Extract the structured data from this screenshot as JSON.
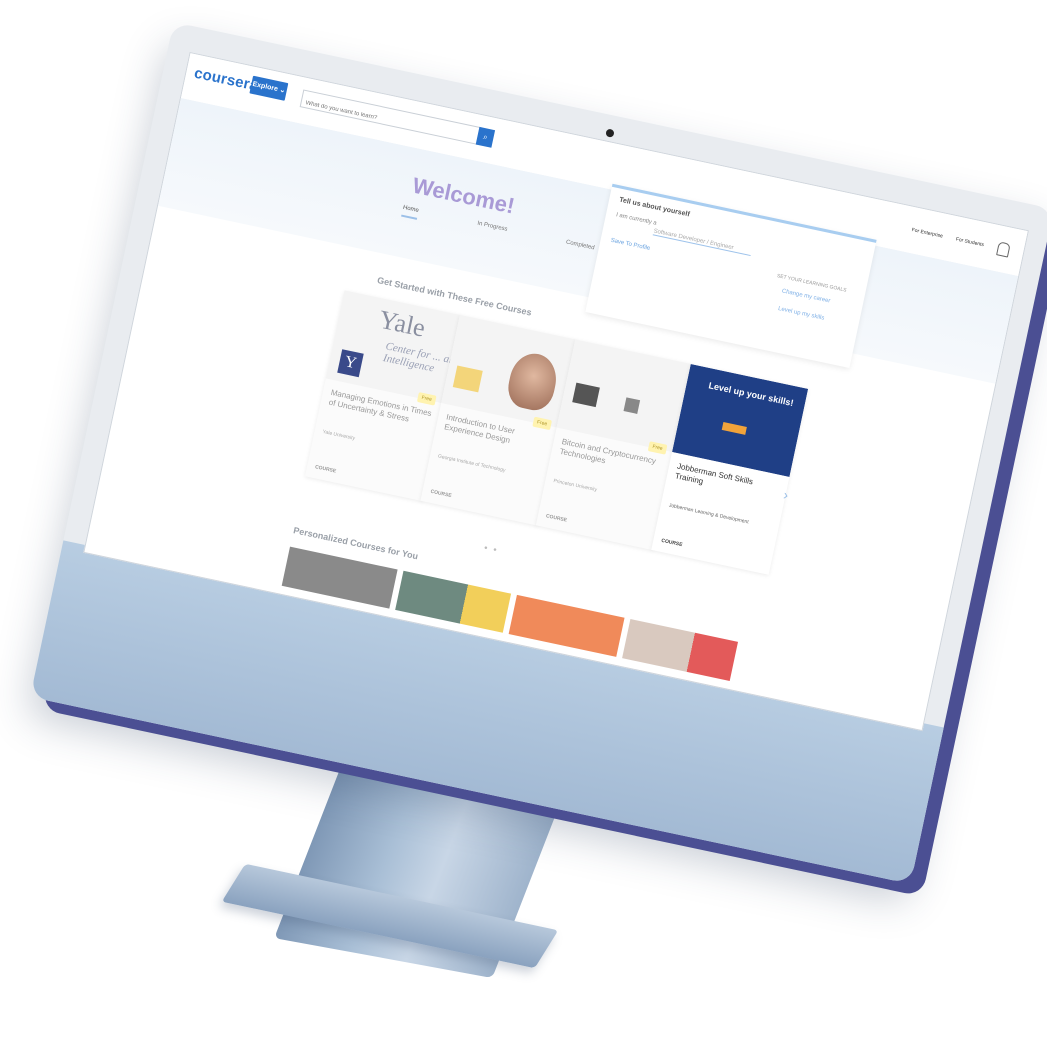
{
  "header": {
    "logo": "coursera",
    "explore_label": "Explore ⌄",
    "search_placeholder": "What do you want to learn?",
    "links": [
      "For Enterprise",
      "For Students"
    ]
  },
  "hero": {
    "welcome": "Welcome!",
    "tabs": [
      "Home",
      "In Progress",
      "Completed"
    ]
  },
  "popup": {
    "title": "Tell us about yourself",
    "current_label": "I am currently a",
    "role_value": "Software Developer / Engineer",
    "save_label": "Save To Profile",
    "goals_title": "SET YOUR LEARNING GOALS",
    "goal1": "Change my career",
    "goal2": "Level up my skills"
  },
  "sections": {
    "free_title": "Get Started with These Free Courses",
    "personal_title": "Personalized Courses for You"
  },
  "cards": [
    {
      "title": "Managing Emotions in Times of Uncertainty & Stress",
      "provider": "Yale University",
      "kind": "COURSE",
      "badge": "Free",
      "image_text": "Yale",
      "image_sub": "Center for ... al Intelligence",
      "image_logo": "Y"
    },
    {
      "title": "Introduction to User Experience Design",
      "provider": "Georgia Institute of Technology",
      "kind": "COURSE",
      "badge": "Free"
    },
    {
      "title": "Bitcoin and Cryptocurrency Technologies",
      "provider": "Princeton University",
      "kind": "COURSE",
      "badge": "Free"
    },
    {
      "title": "Jobberman Soft Skills Training",
      "provider": "Jobberman Learning & Development",
      "kind": "COURSE",
      "image_text": "Level up your skills!"
    }
  ],
  "colors": {
    "brand": "#2a73cc",
    "welcome": "#a99ad6",
    "bezel_shadow": "#4b4f93",
    "chin": "#a3bad4"
  },
  "icons": {
    "search": "search-icon",
    "bell": "bell-icon",
    "next": "chevron-right-icon"
  }
}
